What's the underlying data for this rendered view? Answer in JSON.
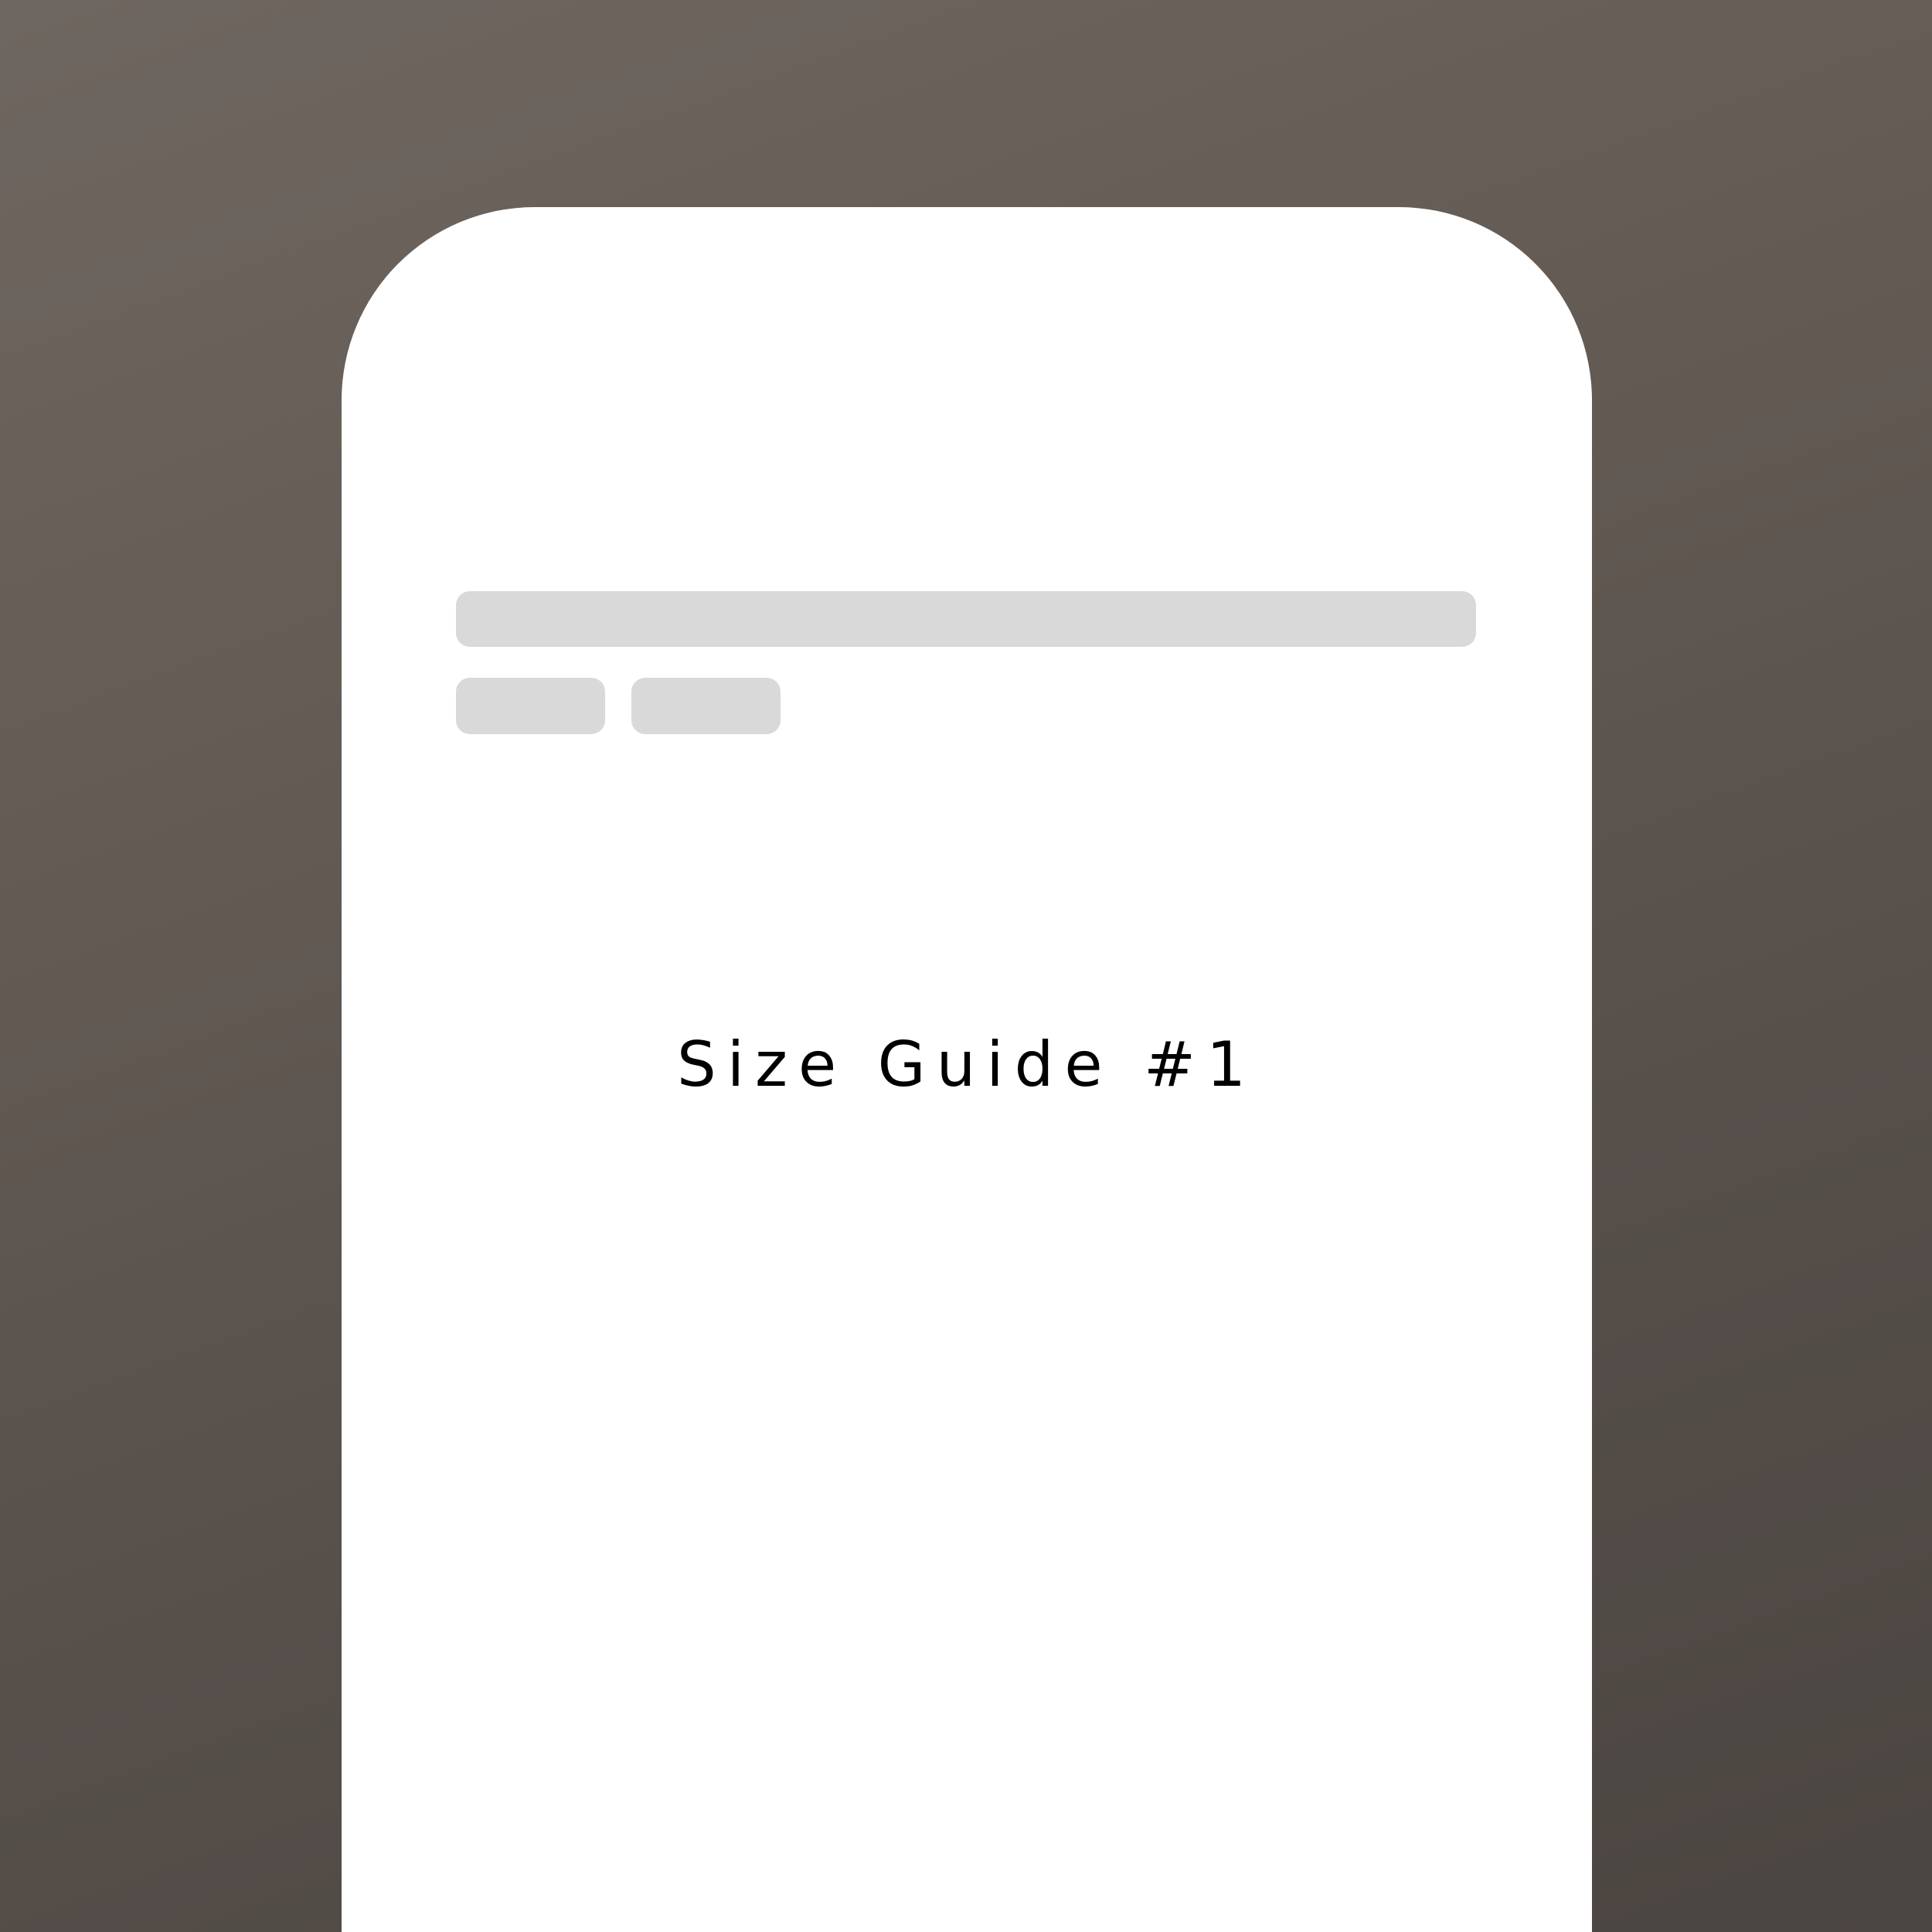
{
  "colors": {
    "backdrop_top": "#6e6660",
    "backdrop_bottom": "#4b4541",
    "card_background": "#ffffff",
    "skeleton_placeholder": "#d9d9d9",
    "heading_text": "#000000"
  },
  "screen": {
    "heading": "Size Guide #1"
  },
  "placeholders": {
    "title_bar": "loading-placeholder",
    "chips": [
      "loading-placeholder",
      "loading-placeholder"
    ]
  }
}
